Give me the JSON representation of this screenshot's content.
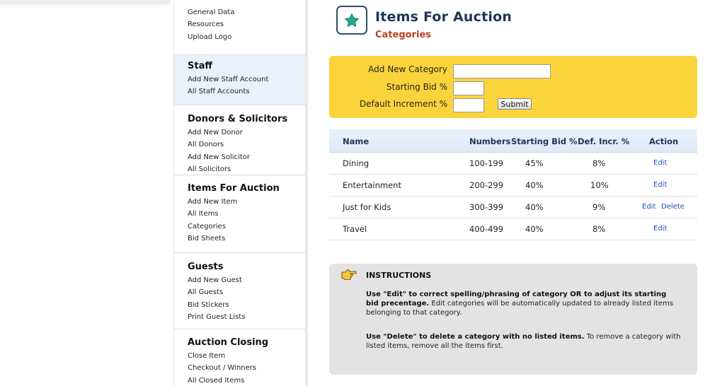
{
  "sidebar": {
    "top_links": [
      "General Data",
      "Resources",
      "Upload Logo"
    ],
    "staff": {
      "title": "Staff",
      "links": [
        "Add New Staff Account",
        "All Staff Accounts"
      ]
    },
    "donors": {
      "title": "Donors & Solicitors",
      "links": [
        "Add New Donor",
        "All Donors",
        "Add New Solicitor",
        "All Solicitors"
      ]
    },
    "items": {
      "title": "Items For Auction",
      "links": [
        "Add New Item",
        "All Items",
        "Categories",
        "Bid Sheets"
      ]
    },
    "guests": {
      "title": "Guests",
      "links": [
        "Add New Guest",
        "All Guests",
        "Bid Stickers",
        "Print Guest Lists"
      ]
    },
    "closing": {
      "title": "Auction Closing",
      "links": [
        "Close Item",
        "Checkout / Winners",
        "All Closed Items"
      ]
    }
  },
  "header": {
    "icon": "star-icon",
    "title": "Items For Auction",
    "subtitle": "Categories"
  },
  "form": {
    "category_label": "Add New Category",
    "category_value": "",
    "starting_bid_label": "Starting Bid %",
    "starting_bid_value": "",
    "increment_label": "Default Increment %",
    "increment_value": "",
    "submit_label": "Submit"
  },
  "table": {
    "headers": {
      "name": "Name",
      "numbers": "Numbers",
      "starting_bid": "Starting Bid %",
      "def_incr": "Def. Incr. %",
      "action": "Action"
    },
    "rows": [
      {
        "name": "Dining",
        "numbers": "100-199",
        "starting_bid": "45%",
        "def_incr": "8%",
        "edit": "Edit",
        "delete": ""
      },
      {
        "name": "Entertainment",
        "numbers": "200-299",
        "starting_bid": "40%",
        "def_incr": "10%",
        "edit": "Edit",
        "delete": ""
      },
      {
        "name": "Just for Kids",
        "numbers": "300-399",
        "starting_bid": "40%",
        "def_incr": "9%",
        "edit": "Edit",
        "delete": "Delete"
      },
      {
        "name": "Travel",
        "numbers": "400-499",
        "starting_bid": "40%",
        "def_incr": "8%",
        "edit": "Edit",
        "delete": ""
      }
    ]
  },
  "instructions": {
    "icon": "pointing-hand-icon",
    "title": "INSTRUCTIONS",
    "p1_bold": "Use \"Edit\" to correct spelling/phrasing of category OR to adjust its starting bid precentage.",
    "p1_rest": " Edit categories will be automatically updated to already listed items belonging to that category.",
    "p2_bold": "Use \"Delete\" to delete a category with no listed items.",
    "p2_rest": " To remove a category with listed items, remove all the items first."
  },
  "colors": {
    "form_bg": "#fbd43b",
    "title": "#1f3556",
    "subtitle": "#b8421f",
    "link": "#1a4fb5",
    "star": "#1fae8e"
  }
}
